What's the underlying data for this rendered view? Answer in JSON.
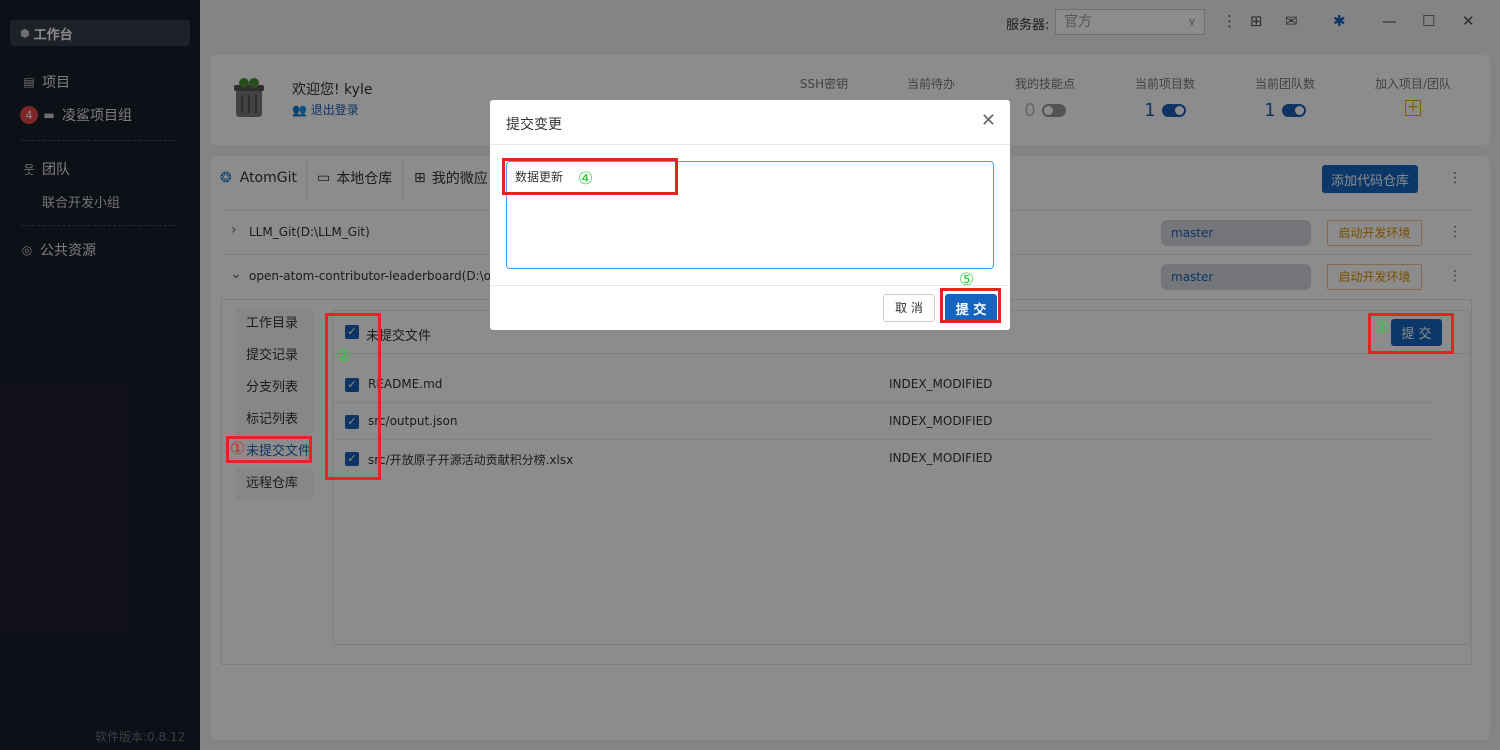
{
  "sidebar": {
    "workbench": "工作台",
    "projects": "项目",
    "project_group_badge": "4",
    "project_group": "凌鲨项目组",
    "team": "团队",
    "team_sub": "联合开发小组",
    "public_resources": "公共资源",
    "version": "软件版本:0.8.12"
  },
  "topbar": {
    "server_label": "服务器:",
    "server_value": "官方"
  },
  "profile": {
    "welcome": "欢迎您! kyle",
    "logout": "退出登录",
    "stats": [
      {
        "label": "SSH密钥",
        "value": ""
      },
      {
        "label": "当前待办",
        "value": ""
      },
      {
        "label": "我的技能点",
        "value": "0"
      },
      {
        "label": "当前项目数",
        "value": "1"
      },
      {
        "label": "当前团队数",
        "value": "1"
      },
      {
        "label": "加入项目/团队",
        "value": ""
      }
    ]
  },
  "tabs": {
    "atomgit": "AtomGit",
    "local_repo": "本地仓库",
    "my_micro": "我的微应",
    "add_repo": "添加代码仓库"
  },
  "repos": [
    {
      "name": "LLM_Git(D:\\LLM_Git)",
      "branch": "master",
      "dev_env": "启动开发环境"
    },
    {
      "name": "open-atom-contributor-leaderboard(D:\\open-",
      "branch": "master",
      "dev_env": "启动开发环境"
    }
  ],
  "leftnav": [
    "工作目录",
    "提交记录",
    "分支列表",
    "标记列表",
    "未提交文件",
    "远程仓库"
  ],
  "files": {
    "header": "未提交文件",
    "commit_btn": "提 交",
    "rows": [
      {
        "name": "README.md",
        "status": "INDEX_MODIFIED"
      },
      {
        "name": "src/output.json",
        "status": "INDEX_MODIFIED"
      },
      {
        "name": "src/开放原子开源活动贡献积分榜.xlsx",
        "status": "INDEX_MODIFIED"
      }
    ]
  },
  "dialog": {
    "title": "提交变更",
    "message": "数据更新",
    "cancel": "取 消",
    "submit": "提 交"
  },
  "annotations": [
    "①",
    "②",
    "③",
    "④",
    "⑤"
  ],
  "colors": {
    "accent": "#1565c0",
    "annotation_box": "#e52323",
    "annotation_number": "#2ecc40"
  }
}
